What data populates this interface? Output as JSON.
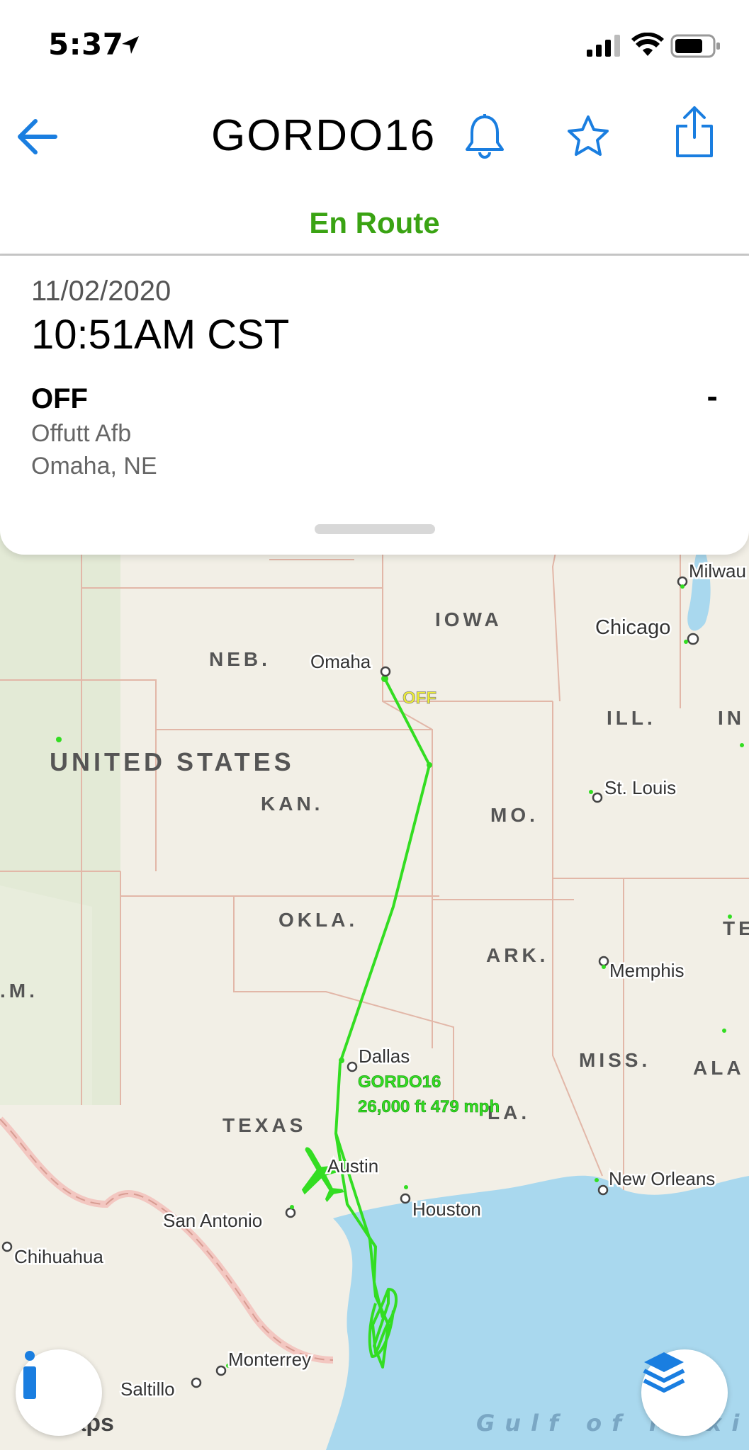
{
  "status_bar": {
    "time": "5:37"
  },
  "nav": {
    "title": "GORDO16"
  },
  "flight_status": "En Route",
  "departure": {
    "date": "11/02/2020",
    "time": "10:51AM CST",
    "code": "OFF",
    "placeholder": "-",
    "airport": "Offutt Afb",
    "city": "Omaha, NE"
  },
  "map": {
    "states": [
      "IOWA",
      "NEB.",
      "ILL.",
      "IN",
      "KAN.",
      "MO.",
      "OKLA.",
      "ARK.",
      "TEN",
      ".M.",
      "MISS.",
      "ALA",
      "TEXAS",
      "LA."
    ],
    "country": "UNITED STATES",
    "cities": [
      "Milwau",
      "Chicago",
      "Omaha",
      "St. Louis",
      "Memphis",
      "Dallas",
      "Austin",
      "Houston",
      "New Orleans",
      "San Antonio",
      "Chihuahua",
      "Monterrey",
      "Saltillo"
    ],
    "water": "Gulf of Mexico",
    "origin_label": "OFF",
    "aircraft_label": "GORDO16",
    "aircraft_detail": "26,000 ft 479 mph",
    "attribution": "Maps",
    "track_color": "#33dd22"
  },
  "icons": {
    "back": "back-arrow-icon",
    "alert": "bell-icon",
    "favorite": "star-icon",
    "share": "share-icon",
    "info": "info-icon",
    "layers": "layers-icon"
  }
}
